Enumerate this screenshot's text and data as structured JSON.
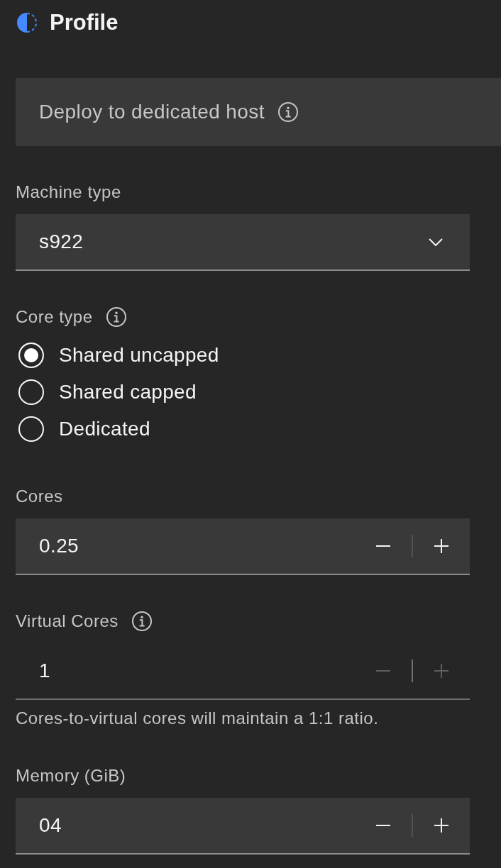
{
  "header": {
    "title": "Profile"
  },
  "dedicated_host": {
    "label": "Deploy to dedicated host",
    "info": true
  },
  "fields": [
    {
      "kind": "select",
      "label": "Machine type",
      "info": false,
      "value": "s922"
    },
    {
      "kind": "radio",
      "label": "Core type",
      "info": true,
      "options": [
        {
          "label": "Shared uncapped",
          "selected": true
        },
        {
          "label": "Shared capped",
          "selected": false
        },
        {
          "label": "Dedicated",
          "selected": false
        }
      ]
    },
    {
      "kind": "number",
      "label": "Cores",
      "info": false,
      "value": "0.25",
      "readonly": false
    },
    {
      "kind": "number",
      "label": "Virtual Cores",
      "info": true,
      "value": "1",
      "readonly": true,
      "helper": "Cores-to-virtual cores will maintain a 1:1 ratio."
    },
    {
      "kind": "number",
      "label": "Memory (GiB)",
      "info": false,
      "value": "04",
      "readonly": false
    }
  ]
}
